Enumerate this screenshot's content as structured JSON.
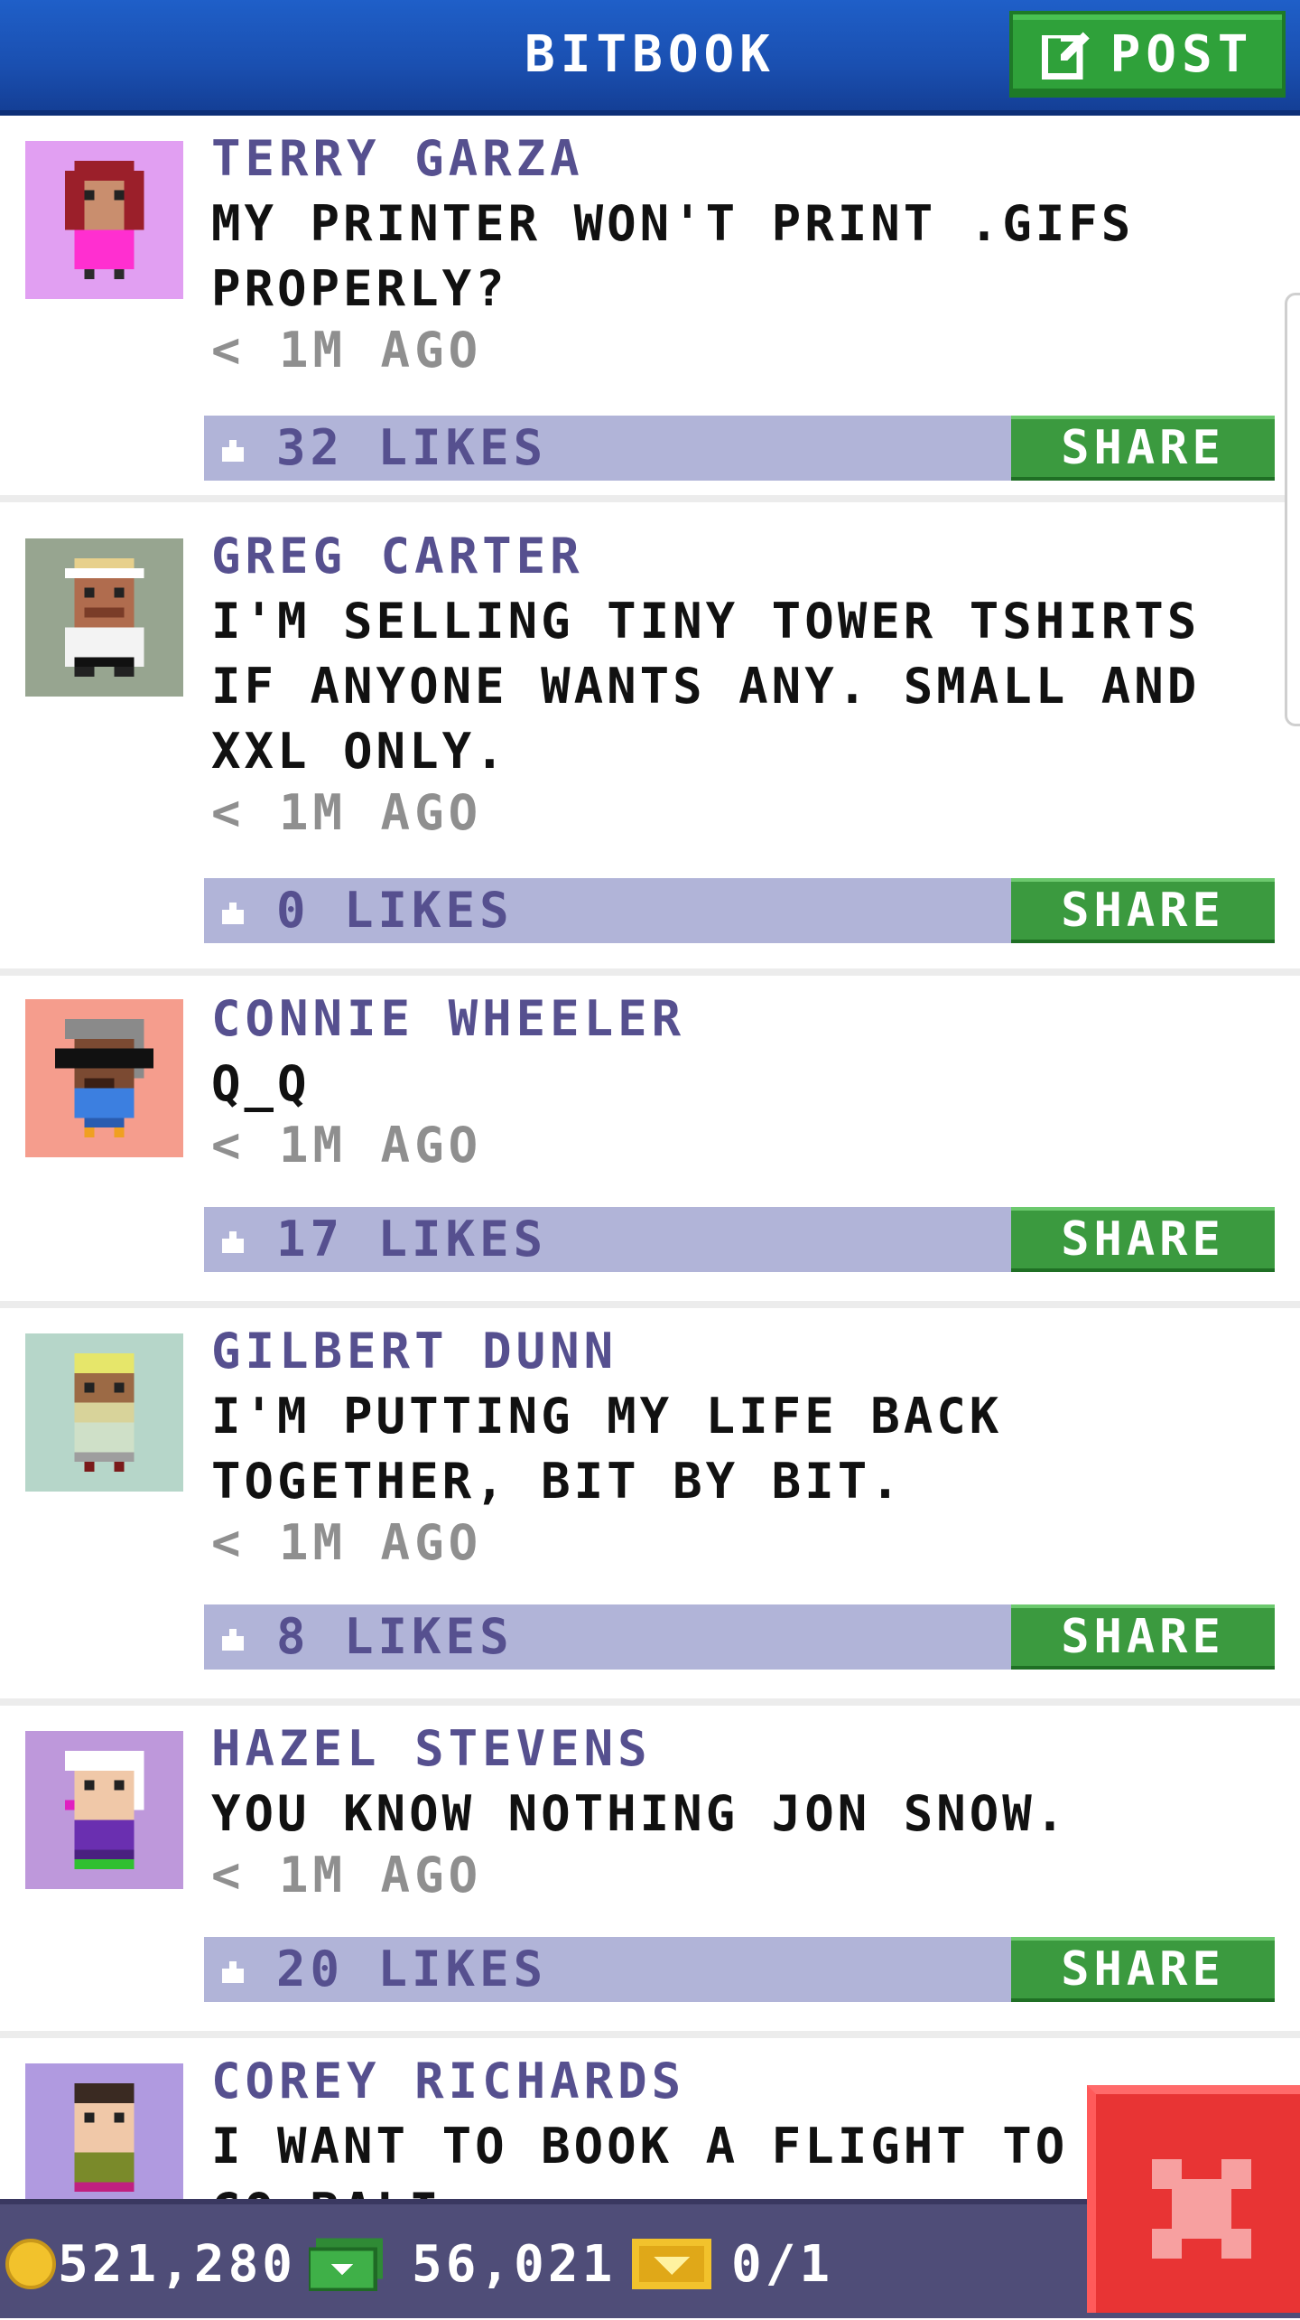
{
  "header": {
    "title": "BITBOOK",
    "post_label": "POST"
  },
  "posts": [
    {
      "author": "TERRY GARZA",
      "text": "MY PRINTER WON'T PRINT .GIFS PROPERLY?",
      "time": "< 1M AGO",
      "likes": "32 LIKES",
      "share": "SHARE",
      "avatar_bg": "#e19ff2"
    },
    {
      "author": "GREG CARTER",
      "text": "I'M SELLING TINY TOWER TSHIRTS IF ANYONE WANTS ANY. SMALL AND XXL ONLY.",
      "time": "< 1M AGO",
      "likes": "0 LIKES",
      "share": "SHARE",
      "avatar_bg": "#97a590"
    },
    {
      "author": "CONNIE WHEELER",
      "text": "Q_Q",
      "time": "< 1M AGO",
      "likes": "17 LIKES",
      "share": "SHARE",
      "avatar_bg": "#f59d8d"
    },
    {
      "author": "GILBERT DUNN",
      "text": "I'M PUTTING MY LIFE BACK TOGETHER, BIT BY BIT.",
      "time": "< 1M AGO",
      "likes": "8 LIKES",
      "share": "SHARE",
      "avatar_bg": "#b6d6c9"
    },
    {
      "author": "HAZEL STEVENS",
      "text": "YOU KNOW NOTHING JON SNOW.",
      "time": "< 1M AGO",
      "likes": "20 LIKES",
      "share": "SHARE",
      "avatar_bg": "#be98db"
    },
    {
      "author": "COREY RICHARDS",
      "text": "I WANT TO BOOK A FLIGHT TO GO BALI.",
      "avatar_bg": "#b09ae0"
    }
  ],
  "status": {
    "coins": "521,280",
    "bux": "56,021",
    "tickets": "0/1"
  },
  "colors": {
    "header": "#1a4fb0",
    "share": "#3b9a3f",
    "likebar": "#b1b4d8",
    "author": "#56508f",
    "close": "#e83434"
  },
  "icons": {
    "post": "edit-icon",
    "like": "thumbs-up-icon",
    "coin": "coin-icon",
    "bux": "bux-icon",
    "ticket": "ticket-icon",
    "close": "close-icon"
  }
}
